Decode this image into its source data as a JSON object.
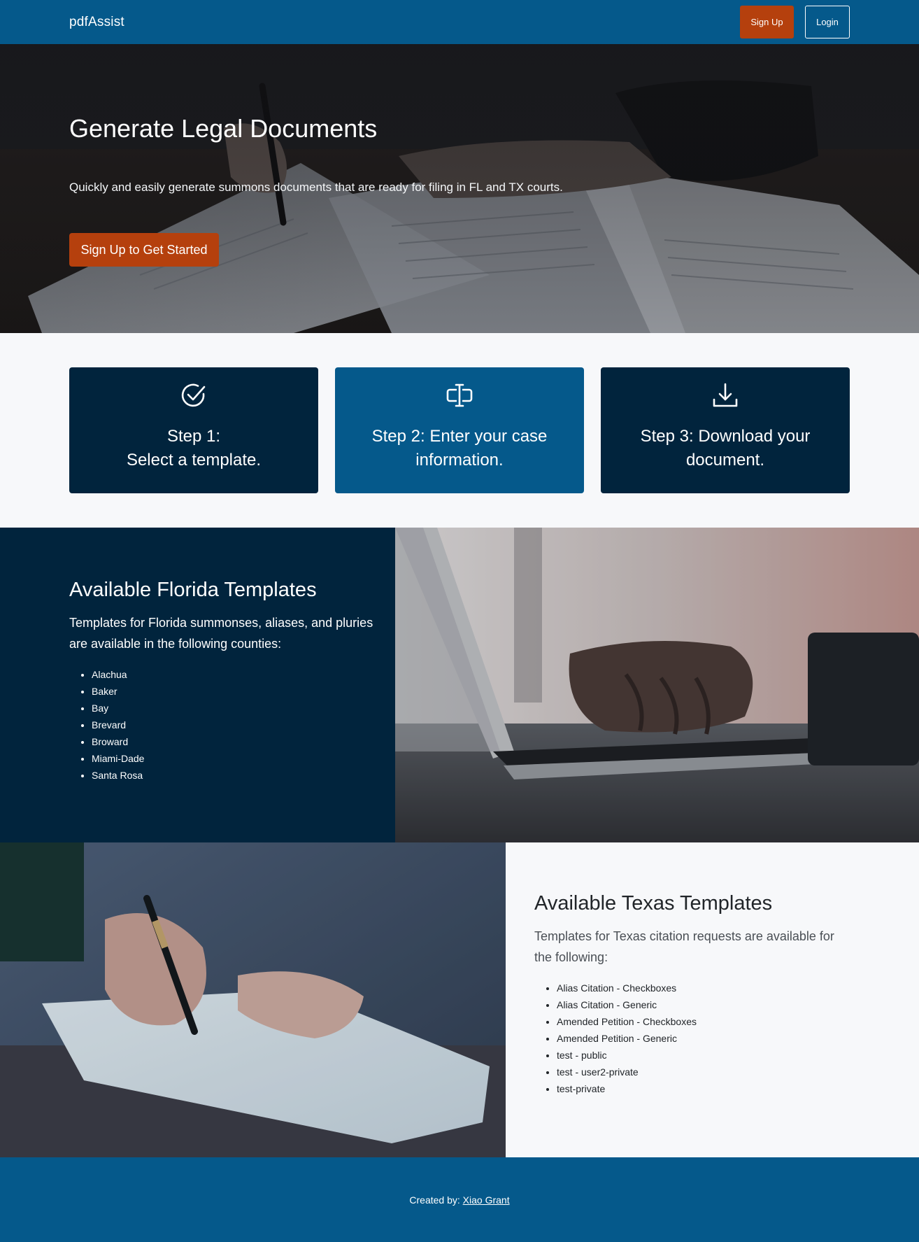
{
  "nav": {
    "brand": "pdfAssist",
    "signup_label": "Sign Up",
    "login_label": "Login"
  },
  "hero": {
    "title": "Generate Legal Documents",
    "subtitle": "Quickly and easily generate summons documents that are ready for filing in FL and TX courts.",
    "cta_label": "Sign Up to Get Started"
  },
  "steps": [
    {
      "line1": "Step 1:",
      "line2": "Select a template.",
      "icon": "check-circle-icon"
    },
    {
      "line1": "Step 2: Enter your case",
      "line2": "information.",
      "icon": "input-cursor-icon"
    },
    {
      "line1": "Step 3: Download your",
      "line2": "document.",
      "icon": "download-icon"
    }
  ],
  "florida": {
    "title": "Available Florida Templates",
    "intro": "Templates for Florida summonses, aliases, and pluries are available in the following counties:",
    "counties": [
      "Alachua",
      "Baker",
      "Bay",
      "Brevard",
      "Broward",
      "Miami-Dade",
      "Santa Rosa"
    ]
  },
  "texas": {
    "title": "Available Texas Templates",
    "intro": "Templates for Texas citation requests are available for the following:",
    "templates": [
      "Alias Citation - Checkboxes",
      "Alias Citation - Generic",
      "Amended Petition - Checkboxes",
      "Amended Petition - Generic",
      "test - public",
      "test - user2-private",
      "test-private"
    ]
  },
  "footer": {
    "prefix": "Created by:",
    "author": "Xiao Grant"
  },
  "colors": {
    "nav": "#05598b",
    "accent": "#b5400d",
    "dark_navy": "#01243d",
    "light_bg": "#f7f8fa"
  }
}
